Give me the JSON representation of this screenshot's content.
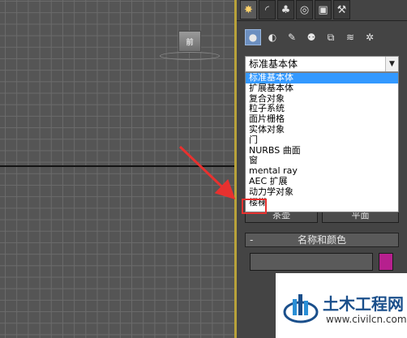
{
  "viewport": {
    "viewcube_label": "前"
  },
  "command_panel": {
    "tabs": [
      {
        "icon": "create-icon",
        "glyph": "✸"
      },
      {
        "icon": "modify-icon",
        "glyph": "◜"
      },
      {
        "icon": "hierarchy-icon",
        "glyph": "♣"
      },
      {
        "icon": "motion-icon",
        "glyph": "◎"
      },
      {
        "icon": "display-icon",
        "glyph": "▣"
      },
      {
        "icon": "utilities-icon",
        "glyph": "⚒"
      }
    ],
    "subcategories": [
      {
        "icon": "geometry-icon",
        "glyph": "●"
      },
      {
        "icon": "shapes-icon",
        "glyph": "◐"
      },
      {
        "icon": "lights-icon",
        "glyph": "✎"
      },
      {
        "icon": "cameras-icon",
        "glyph": "⚉"
      },
      {
        "icon": "helpers-icon",
        "glyph": "⧉"
      },
      {
        "icon": "spacewarps-icon",
        "glyph": "≋"
      },
      {
        "icon": "systems-icon",
        "glyph": "✲"
      }
    ],
    "category_select": {
      "value": "标准基本体"
    },
    "category_options": [
      "标准基本体",
      "扩展基本体",
      "复合对象",
      "粒子系统",
      "面片栅格",
      "实体对象",
      "门",
      "NURBS 曲面",
      "窗",
      "mental ray",
      "AEC 扩展",
      "动力学对象",
      "楼梯"
    ],
    "object_type_buttons": {
      "left_label": "茶壶",
      "right_label": "平面"
    },
    "name_color_rollout": {
      "toggle": "-",
      "title": "名称和颜色",
      "name_value": "",
      "swatch_color": "#b6208e"
    }
  },
  "watermark": {
    "title": "土木工程网",
    "url": "www.civilcn.com"
  }
}
